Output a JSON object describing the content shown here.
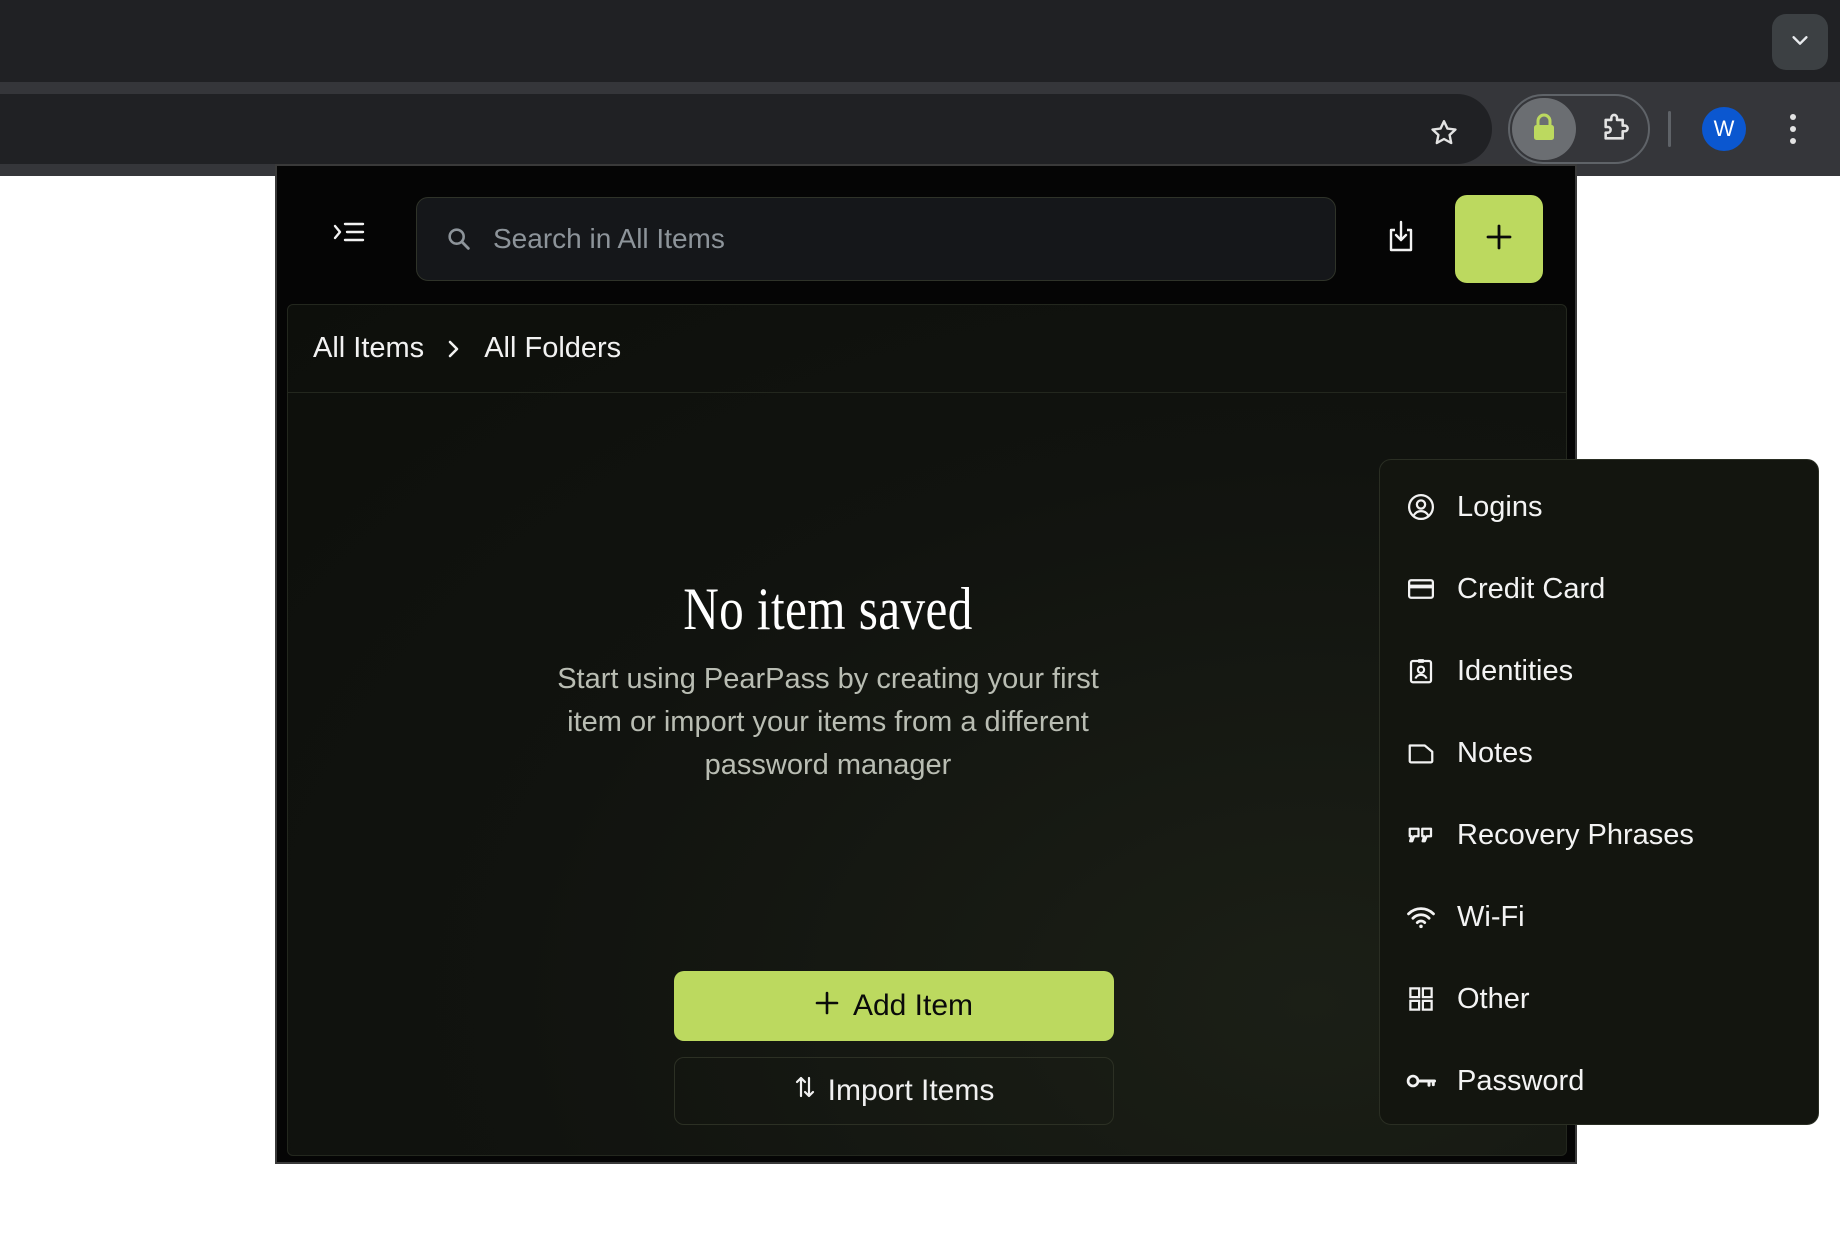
{
  "browser": {
    "profile_initial": "W",
    "icons": [
      "chevron-down-icon",
      "star-icon",
      "lock-icon",
      "puzzle-icon",
      "kebab-icon"
    ]
  },
  "popup": {
    "search": {
      "placeholder": "Search in All Items",
      "value": ""
    },
    "breadcrumb": {
      "root": "All Items",
      "current": "All Folders"
    },
    "empty_state": {
      "title": "No item saved",
      "description": "Start using PearPass by creating your first item or import your items from a different password manager",
      "add_label": "Add Item",
      "import_label": "Import Items"
    },
    "create_menu": [
      {
        "label": "Logins",
        "icon": "user-circle-icon"
      },
      {
        "label": "Credit Card",
        "icon": "credit-card-icon"
      },
      {
        "label": "Identities",
        "icon": "id-badge-icon"
      },
      {
        "label": "Notes",
        "icon": "note-icon"
      },
      {
        "label": "Recovery Phrases",
        "icon": "quote-icon"
      },
      {
        "label": "Wi-Fi",
        "icon": "wifi-icon"
      },
      {
        "label": "Other",
        "icon": "grid-icon"
      },
      {
        "label": "Password",
        "icon": "key-icon"
      }
    ]
  },
  "colors": {
    "accent": "#bcd95f",
    "popup_bg": "#050505",
    "panel_bg": "#11130f",
    "chrome_dark": "#202124",
    "chrome_toolbar": "#35363a"
  }
}
